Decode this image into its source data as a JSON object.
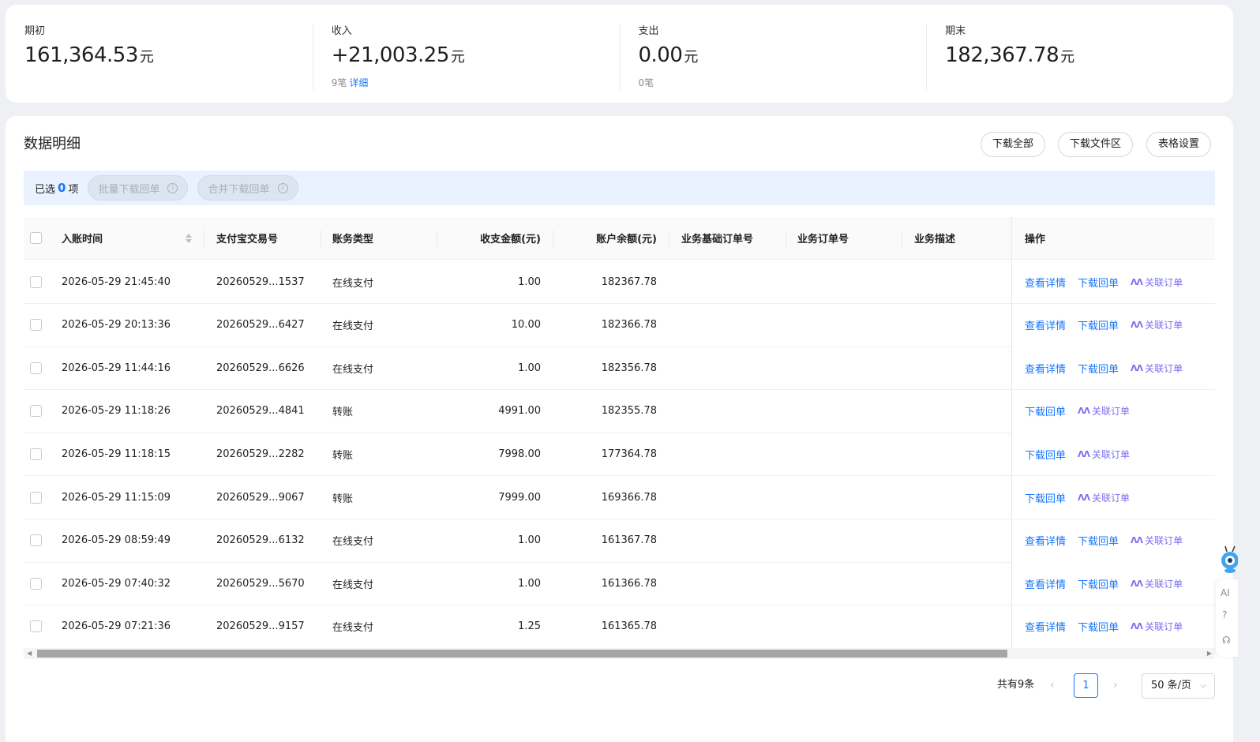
{
  "summary": [
    {
      "label": "期初",
      "amount": "161,364.53",
      "unit": "元",
      "count": "",
      "link": ""
    },
    {
      "label": "收入",
      "amount": "+21,003.25",
      "unit": "元",
      "count": "9笔",
      "link": "详细"
    },
    {
      "label": "支出",
      "amount": "0.00",
      "unit": "元",
      "count": "0笔",
      "link": ""
    },
    {
      "label": "期末",
      "amount": "182,367.78",
      "unit": "元",
      "count": "",
      "link": ""
    }
  ],
  "section_title": "数据明细",
  "toolbar": {
    "download_all": "下载全部",
    "download_area": "下载文件区",
    "table_settings": "表格设置"
  },
  "selection": {
    "prefix": "已选",
    "count": "0",
    "suffix": "项",
    "batch_download": "批量下载回单",
    "merge_download": "合并下载回单"
  },
  "columns": {
    "time": "入账时间",
    "trade_no": "支付宝交易号",
    "type": "账务类型",
    "amount": "收支金额(元)",
    "balance": "账户余额(元)",
    "base_order": "业务基础订单号",
    "order": "业务订单号",
    "desc": "业务描述",
    "ops": "操作"
  },
  "ops_labels": {
    "view": "查看详情",
    "download": "下载回单",
    "link_order": "关联订单",
    "ai_glyph": "ΛΛ"
  },
  "rows": [
    {
      "time": "2026-05-29 21:45:40",
      "trade_no": "20260529...1537",
      "type": "在线支付",
      "amount": "1.00",
      "balance": "182367.78",
      "has_view": true
    },
    {
      "time": "2026-05-29 20:13:36",
      "trade_no": "20260529...6427",
      "type": "在线支付",
      "amount": "10.00",
      "balance": "182366.78",
      "has_view": true
    },
    {
      "time": "2026-05-29 11:44:16",
      "trade_no": "20260529...6626",
      "type": "在线支付",
      "amount": "1.00",
      "balance": "182356.78",
      "has_view": true
    },
    {
      "time": "2026-05-29 11:18:26",
      "trade_no": "20260529...4841",
      "type": "转账",
      "amount": "4991.00",
      "balance": "182355.78",
      "has_view": false
    },
    {
      "time": "2026-05-29 11:18:15",
      "trade_no": "20260529...2282",
      "type": "转账",
      "amount": "7998.00",
      "balance": "177364.78",
      "has_view": false
    },
    {
      "time": "2026-05-29 11:15:09",
      "trade_no": "20260529...9067",
      "type": "转账",
      "amount": "7999.00",
      "balance": "169366.78",
      "has_view": false
    },
    {
      "time": "2026-05-29 08:59:49",
      "trade_no": "20260529...6132",
      "type": "在线支付",
      "amount": "1.00",
      "balance": "161367.78",
      "has_view": true
    },
    {
      "time": "2026-05-29 07:40:32",
      "trade_no": "20260529...5670",
      "type": "在线支付",
      "amount": "1.00",
      "balance": "161366.78",
      "has_view": true
    },
    {
      "time": "2026-05-29 07:21:36",
      "trade_no": "20260529...9157",
      "type": "在线支付",
      "amount": "1.25",
      "balance": "161365.78",
      "has_view": true
    }
  ],
  "pagination": {
    "total": "共有9条",
    "current": "1",
    "page_size": "50 条/页"
  },
  "side_tools": {
    "ai_label": "AI"
  },
  "colors": {
    "accent": "#1677ff",
    "ai": "#7b6ff0",
    "background": "#eef0f4",
    "selection_bar": "#eaf2ff"
  }
}
